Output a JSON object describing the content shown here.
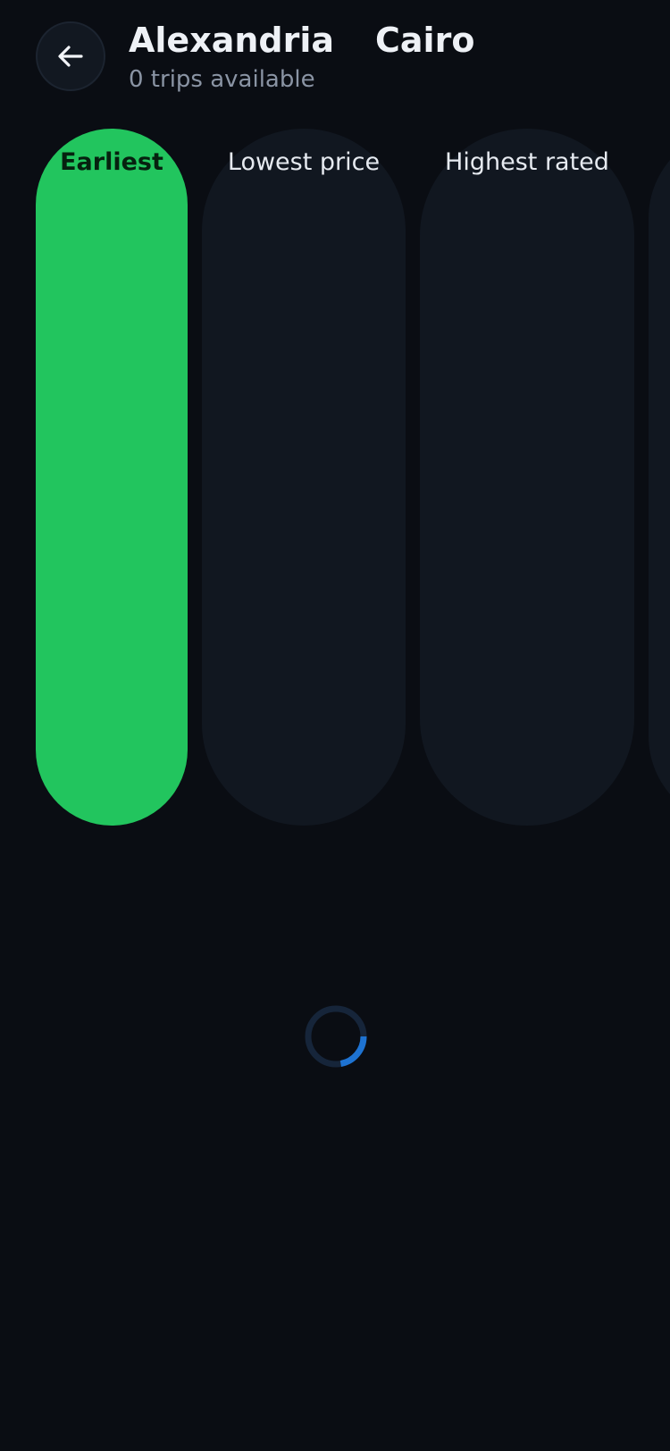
{
  "header": {
    "origin": "Alexandria",
    "destination": "Cairo",
    "trip_count": "0 trips available",
    "back_icon": "arrow-left-icon"
  },
  "filters": [
    {
      "label": "Earliest",
      "active": true
    },
    {
      "label": "Lowest price",
      "active": false
    },
    {
      "label": "Highest rated",
      "active": false
    }
  ],
  "colors": {
    "background": "#0a0d13",
    "accent": "#22c55e",
    "pill_inactive": "#111720",
    "spinner_track": "#16253a",
    "spinner_arc": "#1e73d2"
  },
  "loading": {
    "icon": "loading-spinner-icon"
  }
}
